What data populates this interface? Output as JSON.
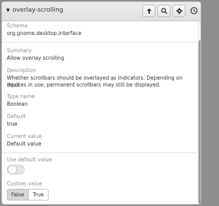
{
  "header": {
    "title": "overlay-scrolling",
    "buttons": [
      {
        "name": "go-up",
        "icon": "arrow-up-icon"
      },
      {
        "name": "search",
        "icon": "search-icon"
      },
      {
        "name": "settings",
        "icon": "gear-icon"
      }
    ],
    "history_icon": "history-icon"
  },
  "schema": {
    "label": "Schema",
    "value": "org.gnome.desktop.interface"
  },
  "summary": {
    "label": "Summary",
    "value": "Allow overlay scrolling"
  },
  "description": {
    "label": "Description",
    "line1": "Whether scrollbars should be overlayed as indicators. Depending on input",
    "line2": "devices in use, permanent scrollbars may still be displayed."
  },
  "type": {
    "label": "Type name",
    "value": "Boolean"
  },
  "default": {
    "label": "Default",
    "value": "true"
  },
  "current": {
    "label": "Current value",
    "value": "Default value"
  },
  "use_default": {
    "label": "Use default value",
    "enabled": false
  },
  "custom": {
    "label": "Custom value",
    "options": [
      "False",
      "True"
    ],
    "selected": "False"
  }
}
